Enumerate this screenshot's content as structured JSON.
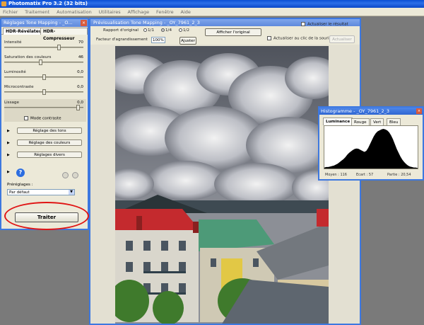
{
  "app": {
    "title": "Photomatix Pro 3.2 (32 bits)"
  },
  "menu": [
    "Fichier",
    "Traitement",
    "Automatisation",
    "Utilitaires",
    "Affichage",
    "Fenêtre",
    "Aide"
  ],
  "tone_panel": {
    "title": "Réglages Tone Mapping - _O...",
    "tabs": [
      "HDR-Révélateur",
      "HDR-Compresseur"
    ],
    "sliders": [
      {
        "label": "Intensité",
        "value": "70",
        "fraction": 0.7
      },
      {
        "label": "Saturation des couleurs",
        "value": "46",
        "fraction": 0.46
      },
      {
        "label": "Luminosité",
        "value": "0,0",
        "fraction": 0.5
      },
      {
        "label": "Microcontraste",
        "value": "0,0",
        "fraction": 0.5
      },
      {
        "label": "Lissage",
        "value": "0,0",
        "fraction": 0.95
      }
    ],
    "mode_contraste": "Mode contraste",
    "expanders": [
      "Réglage des tons",
      "Réglage des couleurs",
      "Réglages divers"
    ],
    "presets_label": "Préréglages :",
    "presets_value": "Par défaut",
    "process_button": "Traiter"
  },
  "preview": {
    "title": "Prévisualisation Tone Mapping - _OY_7961_2_3",
    "ratio_label": "Rapport d'original",
    "ratios": [
      "1/1",
      "1/4",
      "1/2"
    ],
    "show_original": "Afficher l'original",
    "update_box": "Actualiser le résultat",
    "zoom_label": "Facteur d'agrandissement",
    "zoom_value": "100%",
    "adjust_button": "Ajuster",
    "refresh_checkbox": "Actualiser au clic de la souris",
    "refresh_button": "Actualiser"
  },
  "histogram": {
    "title": "Histogramme - _OY_7961_2_3",
    "tabs": [
      "Luminance",
      "Rouge",
      "Vert",
      "Bleu"
    ],
    "footer": [
      "Moyen : 116",
      "Ecart : 57",
      "Partie : 20,54"
    ],
    "values": [
      2,
      3,
      3,
      4,
      5,
      6,
      8,
      10,
      13,
      16,
      19,
      23,
      28,
      32,
      35,
      38,
      40,
      41,
      40,
      38,
      36,
      34,
      36,
      42,
      50,
      58,
      66,
      72,
      76,
      78,
      80,
      81,
      80,
      78,
      74,
      68,
      60,
      50,
      40,
      32,
      24,
      18,
      13,
      9,
      6,
      4,
      3,
      2,
      2,
      1
    ]
  }
}
